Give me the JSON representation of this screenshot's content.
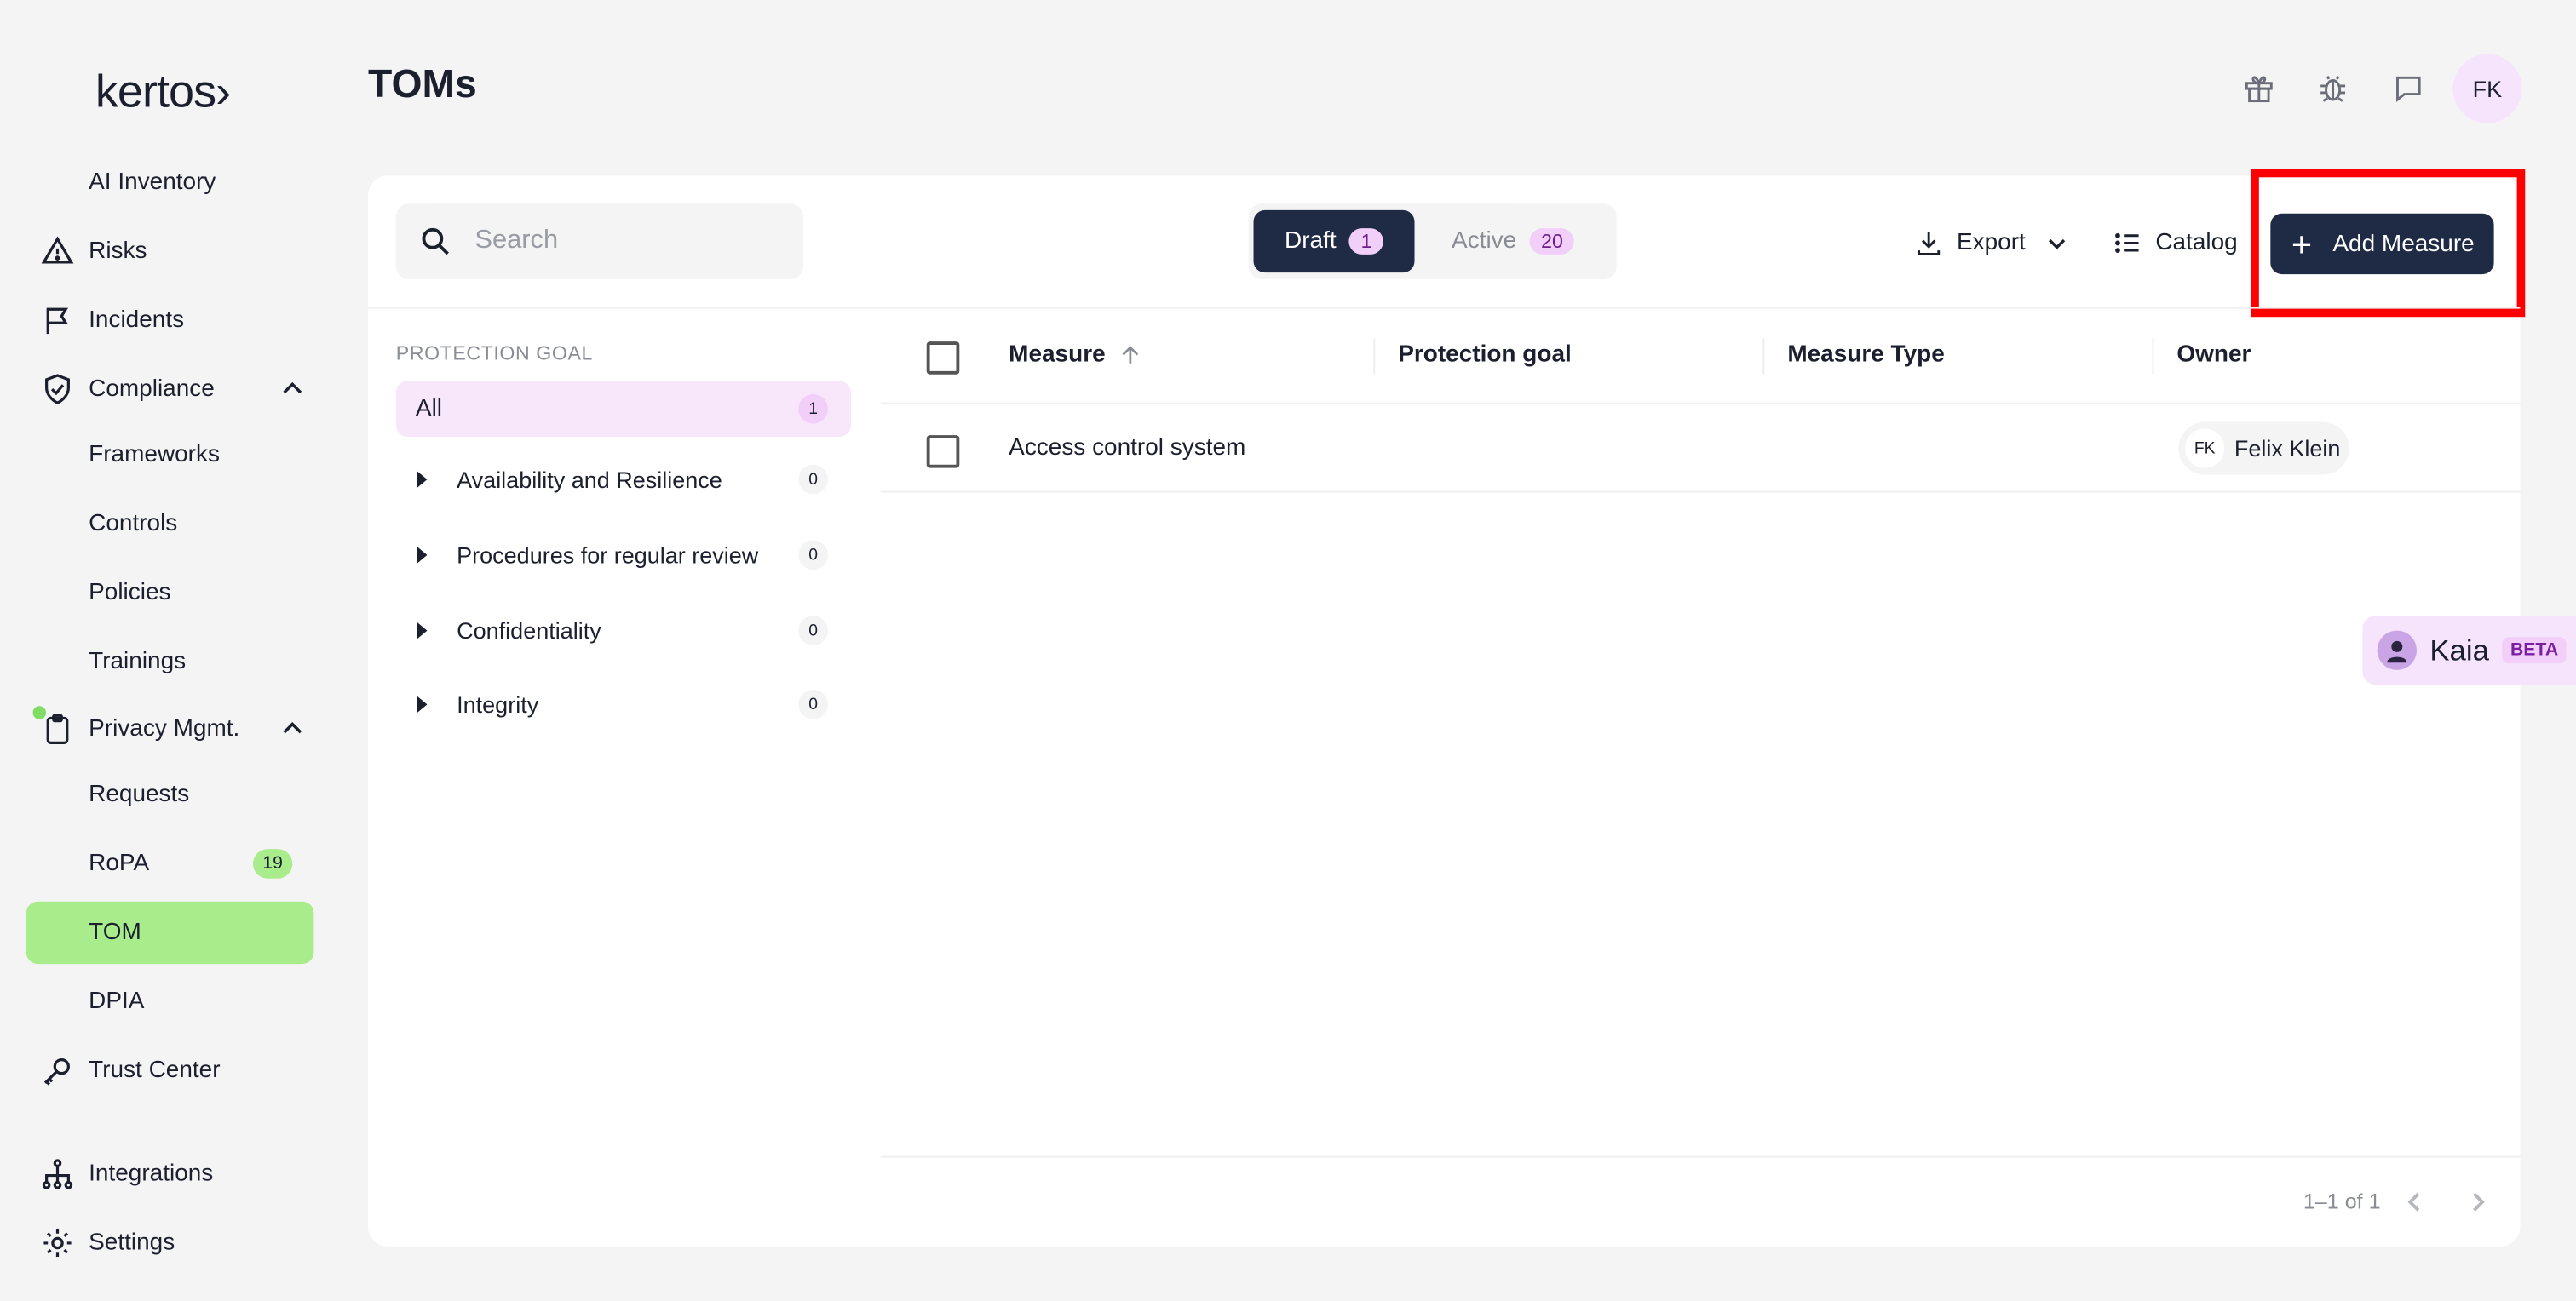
{
  "brand": {
    "logo": "kertos›"
  },
  "sidebar": {
    "partial_item": "AI Inventory",
    "items": [
      {
        "label": "Risks"
      },
      {
        "label": "Incidents"
      },
      {
        "label": "Compliance"
      },
      {
        "label": "Frameworks"
      },
      {
        "label": "Controls"
      },
      {
        "label": "Policies"
      },
      {
        "label": "Trainings"
      },
      {
        "label": "Privacy Mgmt."
      },
      {
        "label": "Requests"
      },
      {
        "label": "RoPA",
        "badge": "19"
      },
      {
        "label": "TOM"
      },
      {
        "label": "DPIA"
      },
      {
        "label": "Trust Center"
      },
      {
        "label": "Integrations"
      },
      {
        "label": "Settings"
      }
    ]
  },
  "header": {
    "title": "TOMs",
    "avatar_initials": "FK"
  },
  "toolbar": {
    "search_placeholder": "Search",
    "tabs": [
      {
        "label": "Draft",
        "count": "1"
      },
      {
        "label": "Active",
        "count": "20"
      }
    ],
    "export_label": "Export",
    "catalog_label": "Catalog",
    "add_label": "Add Measure"
  },
  "filters": {
    "title": "PROTECTION GOAL",
    "all": {
      "label": "All",
      "count": "1"
    },
    "groups": [
      {
        "label": "Availability and Resilience",
        "count": "0"
      },
      {
        "label": "Procedures for regular review",
        "count": "0"
      },
      {
        "label": "Confidentiality",
        "count": "0"
      },
      {
        "label": "Integrity",
        "count": "0"
      }
    ]
  },
  "table": {
    "columns": [
      "Measure",
      "Protection goal",
      "Measure Type",
      "Owner"
    ],
    "rows": [
      {
        "measure": "Access control system",
        "protection_goal": "",
        "measure_type": "",
        "owner_initials": "FK",
        "owner_name": "Felix Klein"
      }
    ],
    "pagination": "1–1 of 1"
  },
  "assistant": {
    "name": "Kaia",
    "badge": "BETA"
  },
  "colors": {
    "accent_green": "#a8ec8b",
    "navy": "#1f2a44",
    "pink": "#f5e4fb",
    "highlight": "#ff0000"
  }
}
